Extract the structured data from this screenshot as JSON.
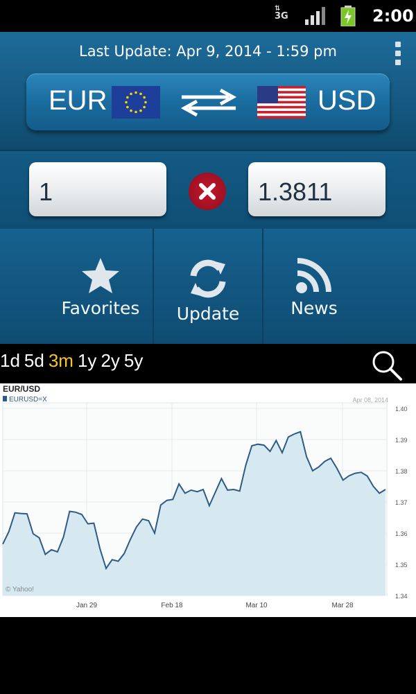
{
  "status_bar": {
    "network": "3G",
    "time": "2:00"
  },
  "header": {
    "last_update": "Last Update: Apr 9, 2014 - 1:59 pm"
  },
  "currency": {
    "from": "EUR",
    "to": "USD"
  },
  "inputs": {
    "amount": "1",
    "result": "1.3811"
  },
  "actions": [
    {
      "label": "Favorites",
      "icon": "star-icon"
    },
    {
      "label": "Update",
      "icon": "refresh-icon"
    },
    {
      "label": "News",
      "icon": "rss-icon"
    }
  ],
  "ranges": [
    "1d",
    "5d",
    "3m",
    "1y",
    "2y",
    "5y"
  ],
  "active_range": "3m",
  "colors": {
    "accent": "#f6c52a",
    "header_blue": "#155981",
    "clear_red": "#c5162b",
    "chart_line": "#2e5b86",
    "chart_fill": "#d6e8f0"
  },
  "chart_data": {
    "type": "area",
    "title": "EUR/USD",
    "legend": "EURUSD=X",
    "date_label": "Apr 08, 2014",
    "credit": "© Yahoo!",
    "x_ticks": [
      "Jan 29",
      "Feb 18",
      "Mar 10",
      "Mar 28"
    ],
    "y_ticks": [
      "1.40",
      "1.39",
      "1.38",
      "1.37",
      "1.36",
      "1.35",
      "1.34"
    ],
    "ylim": [
      1.34,
      1.4
    ],
    "grid": true,
    "series": [
      {
        "values": [
          1.3565,
          1.3605,
          1.3665,
          1.3663,
          1.3662,
          1.3598,
          1.3585,
          1.3532,
          1.3547,
          1.354,
          1.3588,
          1.367,
          1.3667,
          1.366,
          1.363,
          1.3632,
          1.355,
          1.3487,
          1.3515,
          1.351,
          1.3535,
          1.358,
          1.362,
          1.3645,
          1.364,
          1.36,
          1.369,
          1.3705,
          1.3708,
          1.3758,
          1.3728,
          1.3738,
          1.3733,
          1.374,
          1.3688,
          1.3732,
          1.3775,
          1.3738,
          1.374,
          1.3735,
          1.3818,
          1.388,
          1.3885,
          1.3882,
          1.3862,
          1.3897,
          1.3858,
          1.3908,
          1.3918,
          1.3925,
          1.3845,
          1.38,
          1.3812,
          1.383,
          1.384,
          1.3808,
          1.377,
          1.3784,
          1.3792,
          1.3795,
          1.3783,
          1.375,
          1.3728,
          1.374
        ]
      }
    ]
  }
}
